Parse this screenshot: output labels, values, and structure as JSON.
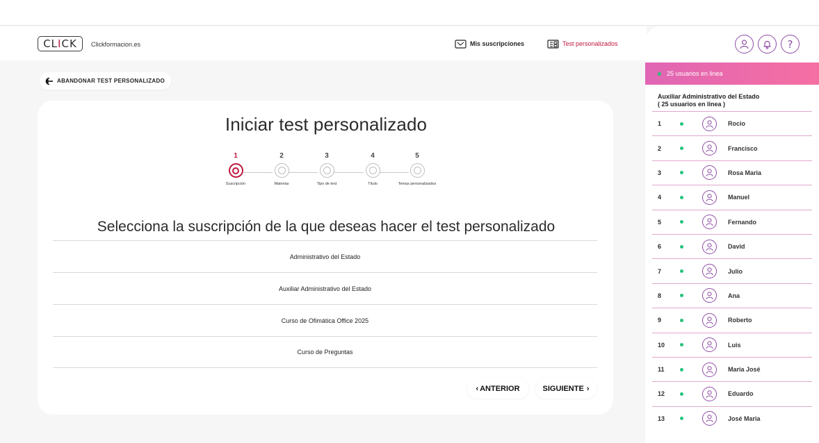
{
  "header": {
    "logo_text": "CLICK",
    "site_name": "Clickformacion.es",
    "nav": [
      {
        "label": "Mis suscripciones",
        "icon": "subscriptions-icon"
      },
      {
        "label": "Test personalizados",
        "icon": "custom-test-icon",
        "active": true
      }
    ]
  },
  "abandon_label": "ABANDONAR TEST PERSONALIZADO",
  "card": {
    "title": "Iniciar test personalizado",
    "steps": [
      {
        "num": "1",
        "label": "Suscripción",
        "active": true
      },
      {
        "num": "2",
        "label": "Materias"
      },
      {
        "num": "3",
        "label": "Tipo de test"
      },
      {
        "num": "4",
        "label": "Título"
      },
      {
        "num": "5",
        "label": "Temas personalizados"
      }
    ],
    "section_title": "Selecciona la suscripción de la que deseas hacer el test personalizado",
    "options": [
      "Administrativo del Estado",
      "Auxiliar Administrativo del Estado",
      "Curso de Ofimática Office 2025",
      "Curso de Preguntas"
    ],
    "prev_label": "ANTERIOR",
    "next_label": "SIGUIENTE"
  },
  "panel": {
    "icons": [
      "user-icon",
      "bell-icon",
      "help-icon"
    ],
    "online_text": "25 usuarios en linea",
    "group_title": "Auxiliar Administrativo del Estado",
    "group_sub": "( 25 usuarios en linea )",
    "users": [
      {
        "num": "1",
        "name": "Rocio"
      },
      {
        "num": "2",
        "name": "Francisco"
      },
      {
        "num": "3",
        "name": "Rosa Maria"
      },
      {
        "num": "4",
        "name": "Manuel"
      },
      {
        "num": "5",
        "name": "Fernando"
      },
      {
        "num": "6",
        "name": "David"
      },
      {
        "num": "7",
        "name": "Julio"
      },
      {
        "num": "8",
        "name": "Ana"
      },
      {
        "num": "9",
        "name": "Roberto"
      },
      {
        "num": "10",
        "name": "Luis"
      },
      {
        "num": "11",
        "name": "Maria José"
      },
      {
        "num": "12",
        "name": "Eduardo"
      },
      {
        "num": "13",
        "name": "José Maria"
      }
    ]
  },
  "colors": {
    "accent": "#c0173f",
    "purple": "#8e4ca5",
    "online": "#27c27b",
    "gradient_start": "#e066b4",
    "gradient_end": "#f56fa2"
  }
}
